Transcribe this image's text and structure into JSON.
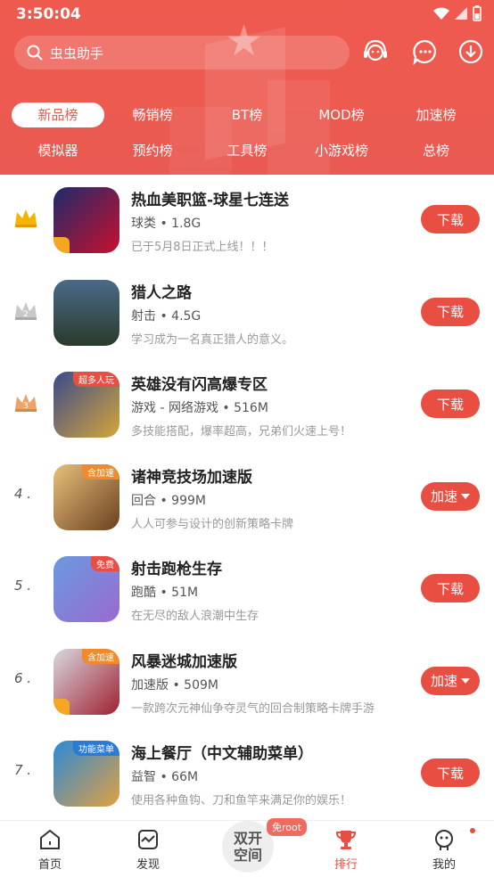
{
  "status": {
    "time": "3:50:04"
  },
  "search": {
    "text": "虫虫助手"
  },
  "tabs": {
    "row1": [
      "新品榜",
      "畅销榜",
      "BT榜",
      "MOD榜",
      "加速榜"
    ],
    "row2": [
      "模拟器",
      "预约榜",
      "工具榜",
      "小游戏榜",
      "总榜"
    ],
    "active": "新品榜"
  },
  "apps": [
    {
      "rank": "1",
      "name": "热血美职篮-球星七连送",
      "meta": "球类 • 1.8G",
      "desc": "已于5月8日正式上线！！！",
      "button": "下载",
      "icon_colors": [
        "#1d2a6b",
        "#c8102e"
      ],
      "badge": ""
    },
    {
      "rank": "2",
      "name": "猎人之路",
      "meta": "射击 • 4.5G",
      "desc": "学习成为一名真正猎人的意义。",
      "button": "下载",
      "icon_colors": [
        "#4a6a8a",
        "#2a3a2a"
      ],
      "badge": ""
    },
    {
      "rank": "3",
      "name": "英雄没有闪高爆专区",
      "meta": "游戏 - 网络游戏 • 516M",
      "desc": "多技能搭配，爆率超高，兄弟们火速上号！",
      "button": "下载",
      "icon_colors": [
        "#3a4b8a",
        "#d4a53a"
      ],
      "badge": "超多人玩"
    },
    {
      "rank": "4 .",
      "name": "诸神竞技场加速版",
      "meta": "回合 • 999M",
      "desc": "人人可参与设计的创新策略卡牌",
      "button": "加速",
      "icon_colors": [
        "#c89a4a",
        "#6a4020"
      ],
      "badge": "含加速"
    },
    {
      "rank": "5 .",
      "name": "射击跑枪生存",
      "meta": "跑酷 • 51M",
      "desc": "在无尽的敌人浪潮中生存",
      "button": "下载",
      "icon_colors": [
        "#6a9ae0",
        "#9a6ad0"
      ],
      "badge": "免费"
    },
    {
      "rank": "6 .",
      "name": "风暴迷城加速版",
      "meta": "加速版 • 509M",
      "desc": "一款跨次元神仙争夺灵气的回合制策略卡牌手游",
      "button": "加速",
      "icon_colors": [
        "#d8d8e0",
        "#a02030"
      ],
      "badge": "含加速"
    },
    {
      "rank": "7 .",
      "name": "海上餐厅（中文辅助菜单）",
      "meta": "益智 • 66M",
      "desc": "使用各种鱼钩、刀和鱼竿来满足你的娱乐！",
      "button": "下载",
      "icon_colors": [
        "#2a8ad8",
        "#e0a040"
      ],
      "badge": "功能菜单"
    }
  ],
  "nav": {
    "home": "首页",
    "discover": "发现",
    "center_line1": "双开",
    "center_line2": "空间",
    "root_badge": "免root",
    "rank": "排行",
    "mine": "我的"
  },
  "colors": {
    "header": "#ec5a50",
    "accent": "#e84e42",
    "crown_gold": "#f5b400",
    "crown_silver": "#c0c0c0",
    "crown_bronze": "#e8a060"
  }
}
